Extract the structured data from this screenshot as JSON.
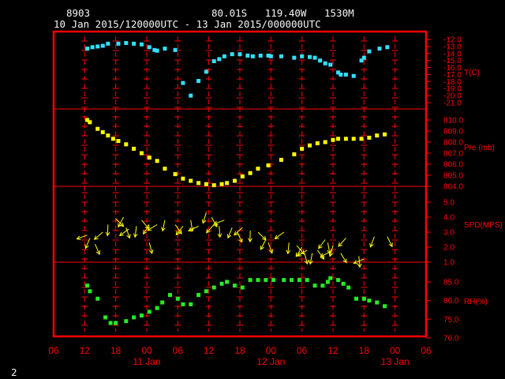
{
  "header": {
    "station_id": "8903",
    "location": "80.01S   119.40W   1530M",
    "time_range": "10 Jan 2015/120000UTC - 13 Jan 2015/000000UTC"
  },
  "page_number": "2",
  "colors": {
    "frame": "#ff0000",
    "grid": "#ff0000",
    "axis_text": "#ff0000",
    "temperature": "#33e0ff",
    "pressure": "#ffff00",
    "wind": "#ffff00",
    "humidity": "#22ee22",
    "text": "#f5f5f5",
    "background": "#000000"
  },
  "chart_data": {
    "type": "scatter",
    "x_axis": {
      "unit": "hours from 10 Jan 06 UTC",
      "range": [
        0,
        72
      ],
      "tick_labels": [
        "06",
        "12",
        "18",
        "00",
        "06",
        "12",
        "18",
        "00",
        "06",
        "12",
        "18",
        "00",
        "06"
      ],
      "date_labels": [
        "11 Jan",
        "12 Jan",
        "13 Jan"
      ]
    },
    "panels": [
      {
        "name": "temperature",
        "label": "T(C)",
        "ylim": [
          -21,
          -12
        ],
        "yticks": [
          "-12.0",
          "-13.0",
          "-14.0",
          "-15.0",
          "-16.0",
          "-17.0",
          "-18.0",
          "-19.0",
          "-20.0",
          "-21.0"
        ],
        "points": [
          [
            6.5,
            -13.3
          ],
          [
            7.5,
            -13.1
          ],
          [
            8.5,
            -13.0
          ],
          [
            9.5,
            -12.9
          ],
          [
            10.5,
            -12.6
          ],
          [
            12.5,
            -12.6
          ],
          [
            14,
            -12.5
          ],
          [
            15.5,
            -12.6
          ],
          [
            17,
            -12.7
          ],
          [
            18.5,
            -13.1
          ],
          [
            19.5,
            -13.5
          ],
          [
            20,
            -13.6
          ],
          [
            21.5,
            -13.3
          ],
          [
            23.5,
            -13.5
          ],
          [
            25,
            -18.2
          ],
          [
            26.5,
            -20.0
          ],
          [
            28,
            -17.9
          ],
          [
            29.5,
            -16.6
          ],
          [
            31,
            -15.1
          ],
          [
            32,
            -14.8
          ],
          [
            33,
            -14.4
          ],
          [
            34.5,
            -14.1
          ],
          [
            36,
            -14.1
          ],
          [
            37.5,
            -14.3
          ],
          [
            38.5,
            -14.4
          ],
          [
            40,
            -14.3
          ],
          [
            41.5,
            -14.3
          ],
          [
            42,
            -14.4
          ],
          [
            44,
            -14.4
          ],
          [
            46.5,
            -14.6
          ],
          [
            48,
            -14.4
          ],
          [
            49.5,
            -14.5
          ],
          [
            50.5,
            -14.6
          ],
          [
            51.5,
            -15.0
          ],
          [
            52.5,
            -15.4
          ],
          [
            53.5,
            -15.6
          ],
          [
            55,
            -16.7
          ],
          [
            55.5,
            -17.0
          ],
          [
            56.5,
            -17.0
          ],
          [
            58,
            -17.2
          ],
          [
            59.5,
            -15.0
          ],
          [
            60,
            -14.6
          ],
          [
            61,
            -13.7
          ],
          [
            63,
            -13.3
          ],
          [
            64.5,
            -13.1
          ]
        ]
      },
      {
        "name": "pressure",
        "label": "Pre (mb)",
        "ylim": [
          804,
          810
        ],
        "yticks": [
          "810.0",
          "809.0",
          "808.0",
          "807.0",
          "806.0",
          "805.0",
          "804.0"
        ],
        "points": [
          [
            6.5,
            810.0
          ],
          [
            7,
            809.8
          ],
          [
            8.5,
            809.2
          ],
          [
            9.5,
            808.9
          ],
          [
            10.5,
            808.6
          ],
          [
            11.5,
            808.3
          ],
          [
            12.5,
            808.1
          ],
          [
            14,
            807.8
          ],
          [
            15.5,
            807.4
          ],
          [
            17,
            807.0
          ],
          [
            18.5,
            806.6
          ],
          [
            20,
            806.3
          ],
          [
            21.5,
            805.6
          ],
          [
            23.5,
            805.1
          ],
          [
            25,
            804.7
          ],
          [
            26.5,
            804.5
          ],
          [
            28,
            804.3
          ],
          [
            29.5,
            804.2
          ],
          [
            31,
            804.1
          ],
          [
            32.5,
            804.2
          ],
          [
            33.5,
            804.3
          ],
          [
            35,
            804.5
          ],
          [
            36.5,
            804.9
          ],
          [
            38,
            805.2
          ],
          [
            39.5,
            805.6
          ],
          [
            41.5,
            805.9
          ],
          [
            44,
            806.4
          ],
          [
            46.5,
            806.9
          ],
          [
            48,
            807.4
          ],
          [
            49.5,
            807.7
          ],
          [
            51,
            807.9
          ],
          [
            52.5,
            808.0
          ],
          [
            54,
            808.2
          ],
          [
            55,
            808.3
          ],
          [
            56.5,
            808.3
          ],
          [
            58,
            808.3
          ],
          [
            59.5,
            808.3
          ],
          [
            61,
            808.4
          ],
          [
            62.5,
            808.6
          ],
          [
            64,
            808.7
          ]
        ]
      },
      {
        "name": "wind",
        "label": "SPD(MPS)",
        "ylim": [
          1,
          5
        ],
        "yticks": [
          "5.0",
          "4.0",
          "3.0",
          "2.0",
          "1.0"
        ],
        "points": [
          [
            6.5,
            2.8
          ],
          [
            7,
            2.6
          ],
          [
            8,
            2.2
          ],
          [
            9.5,
            3.0
          ],
          [
            10.5,
            3.5
          ],
          [
            12,
            3.9
          ],
          [
            13.5,
            4.0
          ],
          [
            14,
            3.3
          ],
          [
            14.5,
            3.2
          ],
          [
            16,
            3.4
          ],
          [
            17,
            3.8
          ],
          [
            18.5,
            3.5
          ],
          [
            18.5,
            2.3
          ],
          [
            20,
            3.5
          ],
          [
            21.5,
            3.8
          ],
          [
            23.5,
            3.5
          ],
          [
            25,
            3.4
          ],
          [
            26.5,
            3.8
          ],
          [
            28,
            3.4
          ],
          [
            29.5,
            4.3
          ],
          [
            30.5,
            4.0
          ],
          [
            31,
            3.5
          ],
          [
            32,
            3.4
          ],
          [
            33,
            3.8
          ],
          [
            34.5,
            3.3
          ],
          [
            35.5,
            3.0
          ],
          [
            36.5,
            3.3
          ],
          [
            38,
            3.1
          ],
          [
            39.5,
            3.0
          ],
          [
            41,
            2.5
          ],
          [
            41.5,
            2.3
          ],
          [
            44.5,
            3.0
          ],
          [
            45.5,
            2.3
          ],
          [
            47,
            2.1
          ],
          [
            48,
            2.0
          ],
          [
            48.5,
            1.6
          ],
          [
            49,
            1.8
          ],
          [
            50,
            1.6
          ],
          [
            51,
            1.8
          ],
          [
            52.5,
            2.5
          ],
          [
            53,
            2.3
          ],
          [
            53.5,
            1.7
          ],
          [
            54,
            2.1
          ],
          [
            55.5,
            1.6
          ],
          [
            56.5,
            2.6
          ],
          [
            59,
            1.4
          ],
          [
            60,
            1.2
          ],
          [
            62,
            2.7
          ],
          [
            64.5,
            2.7
          ]
        ]
      },
      {
        "name": "humidity",
        "label": "RH(%)",
        "ylim": [
          70,
          90
        ],
        "yticks": [
          "85.0",
          "80.0",
          "75.0",
          "70.0"
        ],
        "points": [
          [
            6.5,
            84.0
          ],
          [
            7,
            82.5
          ],
          [
            8.5,
            80.5
          ],
          [
            10,
            75.5
          ],
          [
            11,
            74.0
          ],
          [
            12,
            74.0
          ],
          [
            14,
            74.5
          ],
          [
            15.5,
            75.5
          ],
          [
            17,
            76.0
          ],
          [
            18.5,
            77.0
          ],
          [
            20,
            78.0
          ],
          [
            21,
            79.5
          ],
          [
            22.5,
            81.5
          ],
          [
            24,
            80.5
          ],
          [
            25,
            79.0
          ],
          [
            26.5,
            79.0
          ],
          [
            28,
            81.5
          ],
          [
            29.5,
            82.5
          ],
          [
            31,
            83.5
          ],
          [
            32.5,
            84.5
          ],
          [
            33.5,
            85.0
          ],
          [
            35,
            84.0
          ],
          [
            36.5,
            83.5
          ],
          [
            38,
            85.5
          ],
          [
            39.5,
            85.5
          ],
          [
            41,
            85.5
          ],
          [
            42.5,
            85.5
          ],
          [
            44.5,
            85.5
          ],
          [
            46,
            85.5
          ],
          [
            47.5,
            85.5
          ],
          [
            49,
            85.5
          ],
          [
            50.5,
            84.0
          ],
          [
            52,
            84.0
          ],
          [
            53,
            85.0
          ],
          [
            53.5,
            86.0
          ],
          [
            55,
            85.5
          ],
          [
            56,
            84.5
          ],
          [
            57,
            83.5
          ],
          [
            58.5,
            80.5
          ],
          [
            60,
            80.5
          ],
          [
            61,
            80.0
          ],
          [
            62.5,
            79.5
          ],
          [
            64,
            78.5
          ]
        ]
      }
    ]
  }
}
